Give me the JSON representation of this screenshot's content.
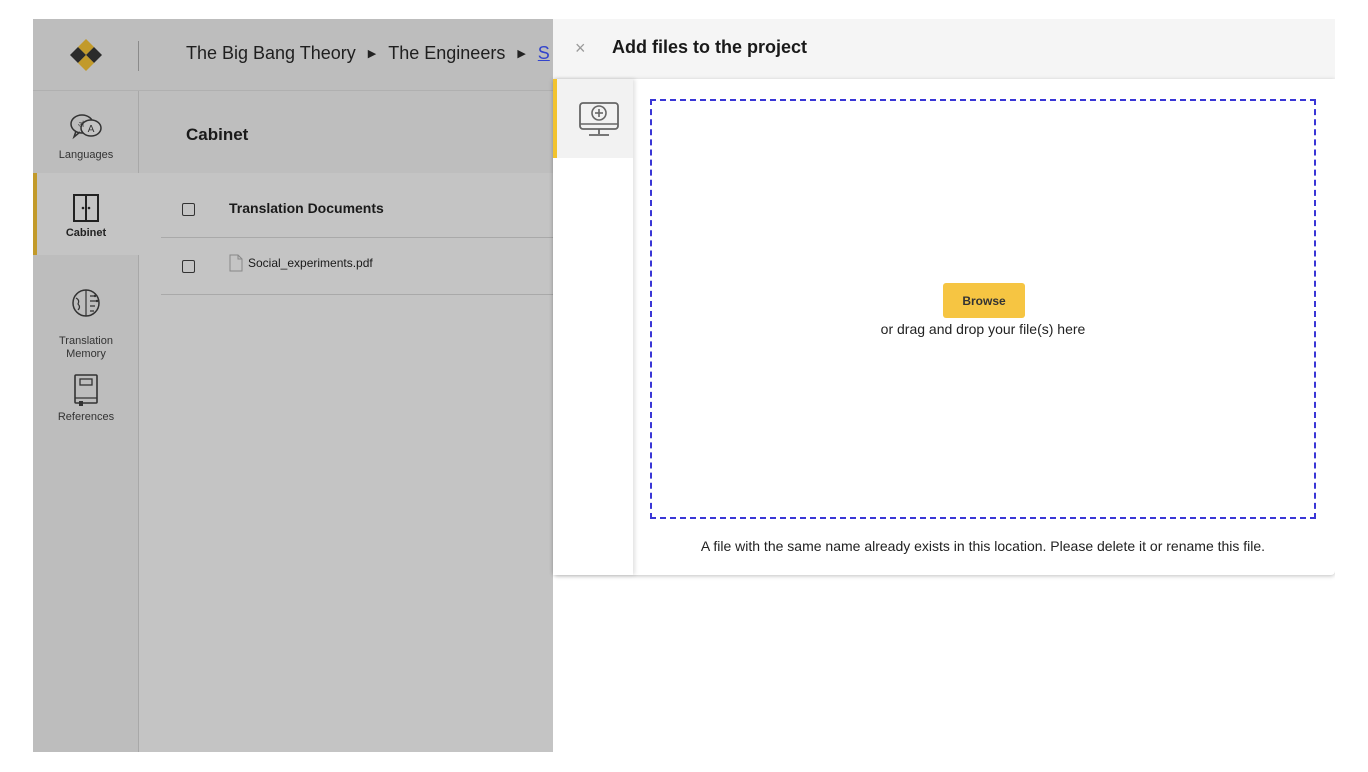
{
  "breadcrumb": {
    "items": [
      "The Big Bang Theory",
      "The Engineers"
    ],
    "current": "S",
    "separator": "▶"
  },
  "nav": {
    "items": [
      {
        "label": "Languages",
        "icon": "languages-icon",
        "active": false
      },
      {
        "label": "Cabinet",
        "icon": "cabinet-icon",
        "active": true
      },
      {
        "label": "Translation\nMemory",
        "icon": "brain-icon",
        "active": false
      },
      {
        "label": "References",
        "icon": "book-icon",
        "active": false
      }
    ]
  },
  "content": {
    "title": "Cabinet",
    "header_row": "Translation Documents",
    "files": [
      "Social_experiments.pdf"
    ]
  },
  "dialog": {
    "close": "×",
    "title": "Add files to the project",
    "source_tab_icon": "computer-upload-icon",
    "browse_label": "Browse",
    "drop_hint": "or drag and drop your file(s) here",
    "error": "A file with the same name already exists in this location. Please delete it or rename this file."
  },
  "colors": {
    "accent": "#f6c542",
    "active_marker": "#c29a2a",
    "dropzone_border": "#3a36d6",
    "overlay": "#c4c4c4"
  }
}
